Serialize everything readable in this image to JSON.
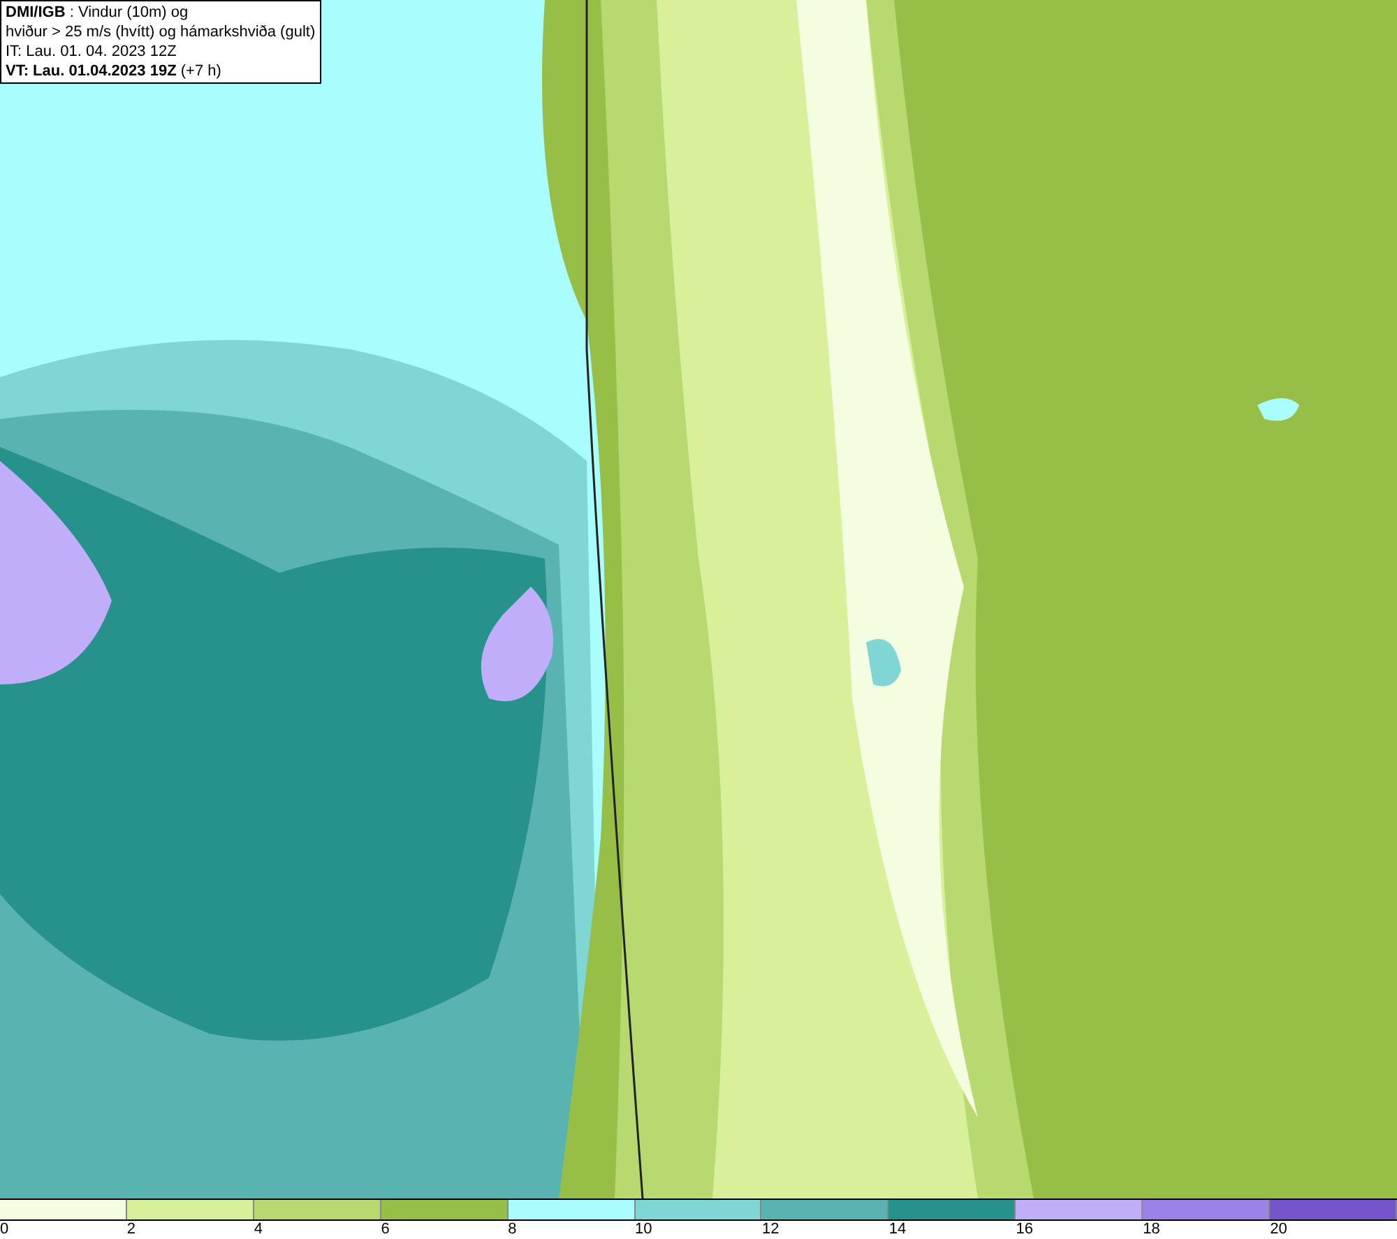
{
  "title_box": {
    "lines": [
      "**DMI/IGB** : Vindur (10m) og",
      "hviður > 25 m/s (hvítt) og hámarkshviða (gult)",
      "IT: Lau. 01. 04. 2023 12Z",
      "**VT: Lau. 01.04.2023 19Z** (+7 h)"
    ]
  },
  "legend": {
    "segments": [
      {
        "color": "#f5fde0"
      },
      {
        "color": "#d9f09a"
      },
      {
        "color": "#b7d970"
      },
      {
        "color": "#97bf47"
      },
      {
        "color": "#a9fdfc"
      },
      {
        "color": "#7fd6d3"
      },
      {
        "color": "#58b3b1"
      },
      {
        "color": "#27918c"
      },
      {
        "color": "#c0aefb"
      },
      {
        "color": "#9a82e6"
      },
      {
        "color": "#7654cc"
      }
    ],
    "labels": [
      "0",
      "2",
      "4",
      "6",
      "8",
      "10",
      "12",
      "14",
      "16",
      "18",
      "20"
    ]
  }
}
